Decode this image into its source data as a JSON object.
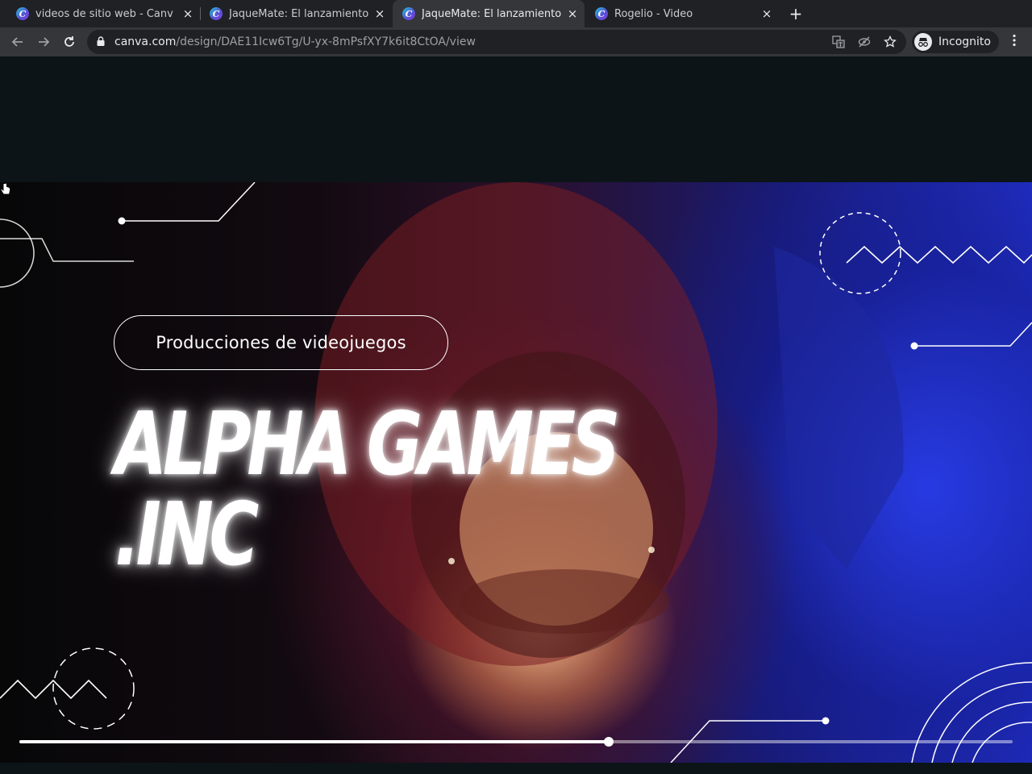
{
  "browser": {
    "tabs": [
      {
        "title": "videos de sitio web - Canv",
        "active": false
      },
      {
        "title": "JaqueMate: El lanzamiento",
        "active": false
      },
      {
        "title": "JaqueMate: El lanzamiento",
        "active": true
      },
      {
        "title": "Rogelio - Video",
        "active": false
      }
    ],
    "new_tab_label": "+",
    "tab_close_glyph": "×",
    "favicon_letter": "C",
    "url_domain": "canva.com",
    "url_path": "/design/DAE11Icw6Tg/U-yx-8mPsfXY7k6it8CtOA/view",
    "incognito_label": "Incognito",
    "icons": [
      "back-icon",
      "forward-icon",
      "reload-icon",
      "lock-icon",
      "translate-icon",
      "tracking-blocked-icon",
      "bookmark-star-icon",
      "incognito-icon",
      "menu-dots-icon"
    ]
  },
  "video": {
    "tagline": "Producciones de videojuegos",
    "headline_line1": "ALPHA GAMES",
    "headline_line2": ".INC",
    "progress_fraction": 0.593
  },
  "colors": {
    "tab_strip": "#202124",
    "toolbar": "#35363a",
    "page_bg": "#0c1418",
    "accent_blue": "#2230c8"
  }
}
